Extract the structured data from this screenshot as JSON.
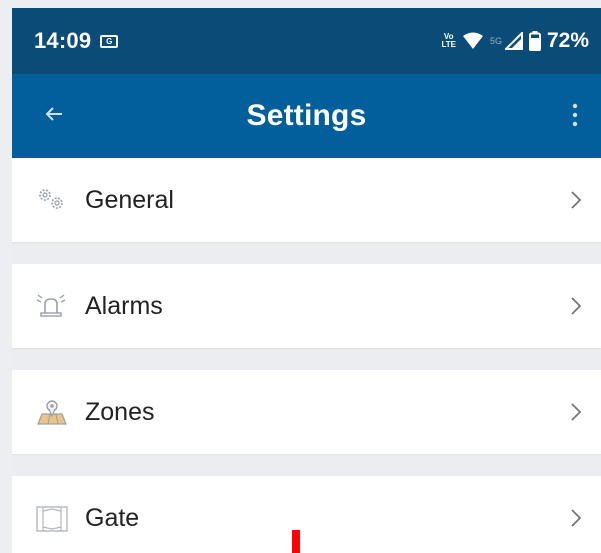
{
  "status_bar": {
    "time": "14:09",
    "notification_badge": "G",
    "volte_line1": "Vo",
    "volte_line2": "LTE",
    "network": "5G",
    "battery_percent": "72%"
  },
  "app_bar": {
    "title": "Settings",
    "back_icon": "arrow-left-icon",
    "menu_icon": "more-vertical-icon"
  },
  "settings_items": [
    {
      "label": "General",
      "icon": "gears-icon"
    },
    {
      "label": "Alarms",
      "icon": "alarm-siren-icon"
    },
    {
      "label": "Zones",
      "icon": "map-pin-icon"
    },
    {
      "label": "Gate",
      "icon": "gate-icon"
    }
  ],
  "colors": {
    "status_bar": "#0b4b78",
    "app_bar": "#035f9b",
    "background": "#ebedf0",
    "card": "#ffffff",
    "accent_marker": "#ff0000"
  }
}
